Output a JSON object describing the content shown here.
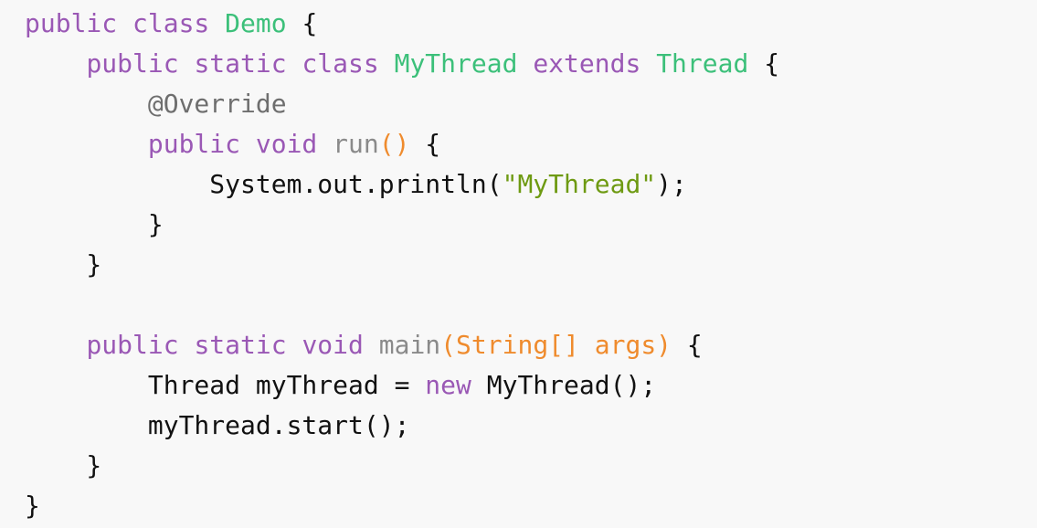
{
  "code": {
    "lines": [
      [
        {
          "t": "public class ",
          "c": "kw"
        },
        {
          "t": "Demo",
          "c": "ty"
        },
        {
          "t": " {",
          "c": "pl"
        }
      ],
      [
        {
          "t": "    ",
          "c": "pl"
        },
        {
          "t": "public static class ",
          "c": "kw"
        },
        {
          "t": "MyThread",
          "c": "ty"
        },
        {
          "t": " ",
          "c": "pl"
        },
        {
          "t": "extends",
          "c": "kw"
        },
        {
          "t": " ",
          "c": "pl"
        },
        {
          "t": "Thread",
          "c": "ty"
        },
        {
          "t": " {",
          "c": "pl"
        }
      ],
      [
        {
          "t": "        ",
          "c": "pl"
        },
        {
          "t": "@Override",
          "c": "an"
        }
      ],
      [
        {
          "t": "        ",
          "c": "pl"
        },
        {
          "t": "public void ",
          "c": "kw"
        },
        {
          "t": "run",
          "c": "fn"
        },
        {
          "t": "()",
          "c": "pa"
        },
        {
          "t": " {",
          "c": "pl"
        }
      ],
      [
        {
          "t": "            System.out.println(",
          "c": "pl"
        },
        {
          "t": "\"MyThread\"",
          "c": "st"
        },
        {
          "t": ");",
          "c": "pl"
        }
      ],
      [
        {
          "t": "        }",
          "c": "pl"
        }
      ],
      [
        {
          "t": "    }",
          "c": "pl"
        }
      ],
      [
        {
          "t": "",
          "c": "pl"
        }
      ],
      [
        {
          "t": "    ",
          "c": "pl"
        },
        {
          "t": "public static void ",
          "c": "kw"
        },
        {
          "t": "main",
          "c": "fn"
        },
        {
          "t": "(String[] args)",
          "c": "pa"
        },
        {
          "t": " {",
          "c": "pl"
        }
      ],
      [
        {
          "t": "        Thread myThread = ",
          "c": "pl"
        },
        {
          "t": "new",
          "c": "kw"
        },
        {
          "t": " MyThread();",
          "c": "pl"
        }
      ],
      [
        {
          "t": "        myThread.start();",
          "c": "pl"
        }
      ],
      [
        {
          "t": "    }",
          "c": "pl"
        }
      ],
      [
        {
          "t": "}",
          "c": "pl"
        }
      ]
    ]
  },
  "colors": {
    "background": "#f8f8f8",
    "keyword": "#9a58b5",
    "type": "#3cc07a",
    "annotation": "#6e6e6e",
    "function": "#8a8a8a",
    "params": "#ef8b2d",
    "string": "#6e9a12",
    "plain": "#111111"
  }
}
